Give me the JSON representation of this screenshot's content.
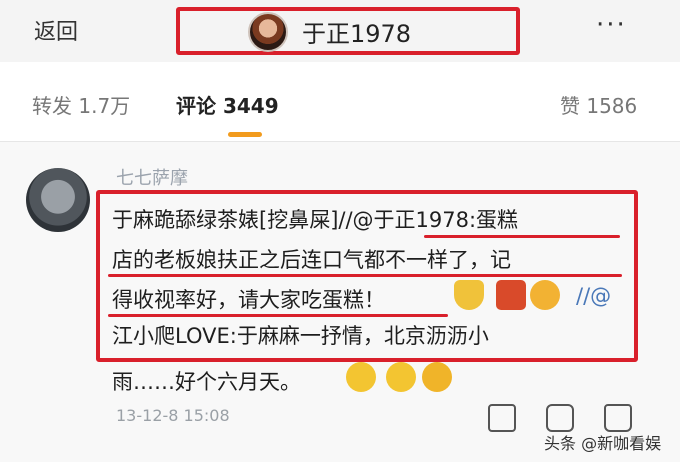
{
  "header": {
    "back_label": "返回",
    "title": "于正1978",
    "more_label": "···"
  },
  "tabs": {
    "repost": "转发 1.7万",
    "comment": "评论 3449",
    "like": "赞 1586"
  },
  "comment": {
    "username": "七七萨摩",
    "lines": [
      "于麻跪舔绿茶婊[挖鼻屎]//@于正1978:蛋糕",
      "店的老板娘扶正之后连口气都不一样了，记",
      "得收视率好，请大家吃蛋糕！",
      "//@",
      "江小爬LOVE:于麻麻一抒情，北京沥沥小",
      "雨……好个六月天。"
    ],
    "timestamp": "13-12-8 15:08"
  },
  "watermark": "头条 @新咖看娱",
  "colors": {
    "highlight_red": "#d9202b",
    "tab_accent": "#f29b1d",
    "mention_blue": "#4a78b8"
  }
}
